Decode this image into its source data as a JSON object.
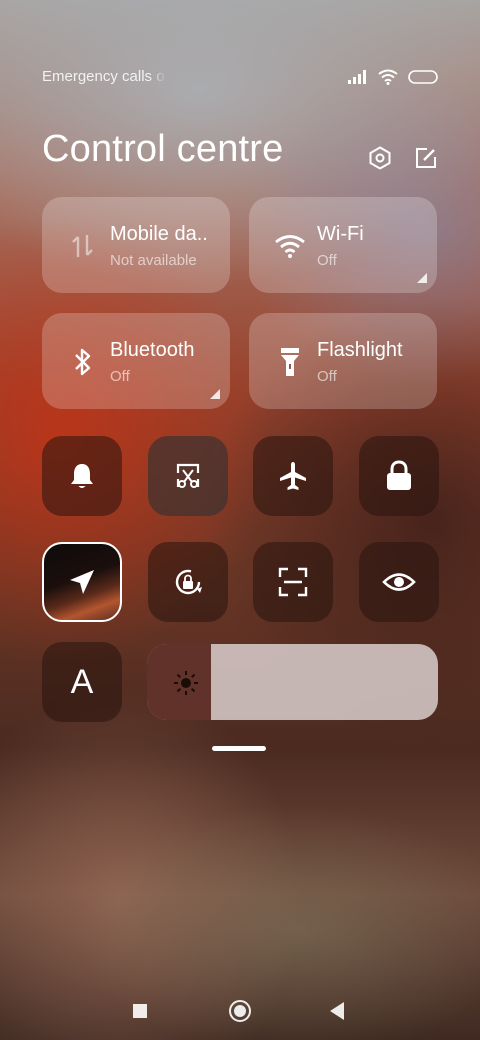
{
  "status_bar": {
    "carrier_text": "Emergency calls o",
    "icons": [
      "signal-icon",
      "wifi-icon",
      "battery-icon"
    ]
  },
  "header": {
    "title": "Control centre",
    "icons": [
      "settings-icon",
      "edit-icon"
    ]
  },
  "tiles": [
    {
      "name": "mobile-data",
      "label": "Mobile da..",
      "status": "Not available",
      "icon": "mobile-data-icon",
      "has_corner": false
    },
    {
      "name": "wifi",
      "label": "Wi-Fi",
      "status": "Off",
      "icon": "wifi-icon",
      "has_corner": true
    },
    {
      "name": "bluetooth",
      "label": "Bluetooth",
      "status": "Off",
      "icon": "bluetooth-icon",
      "has_corner": true
    },
    {
      "name": "flashlight",
      "label": "Flashlight",
      "status": "Off",
      "icon": "flashlight-icon",
      "has_corner": false
    }
  ],
  "toggles_row1": [
    "bell-icon",
    "screenshot-icon",
    "airplane-icon",
    "lock-icon"
  ],
  "toggles_row2": [
    "location-icon",
    "rotation-lock-icon",
    "scan-icon",
    "eye-icon"
  ],
  "font_button": {
    "label": "A",
    "icon": "font-size-icon"
  },
  "brightness": {
    "level": 0.22,
    "icon": "brightness-icon"
  },
  "navigation": [
    "recents-button",
    "home-button",
    "back-button"
  ],
  "colors": {
    "tile_bg": "rgba(255,255,255,0.22)",
    "toggle_bg": "rgba(40,20,15,0.55)",
    "text_primary": "#ffffff"
  }
}
